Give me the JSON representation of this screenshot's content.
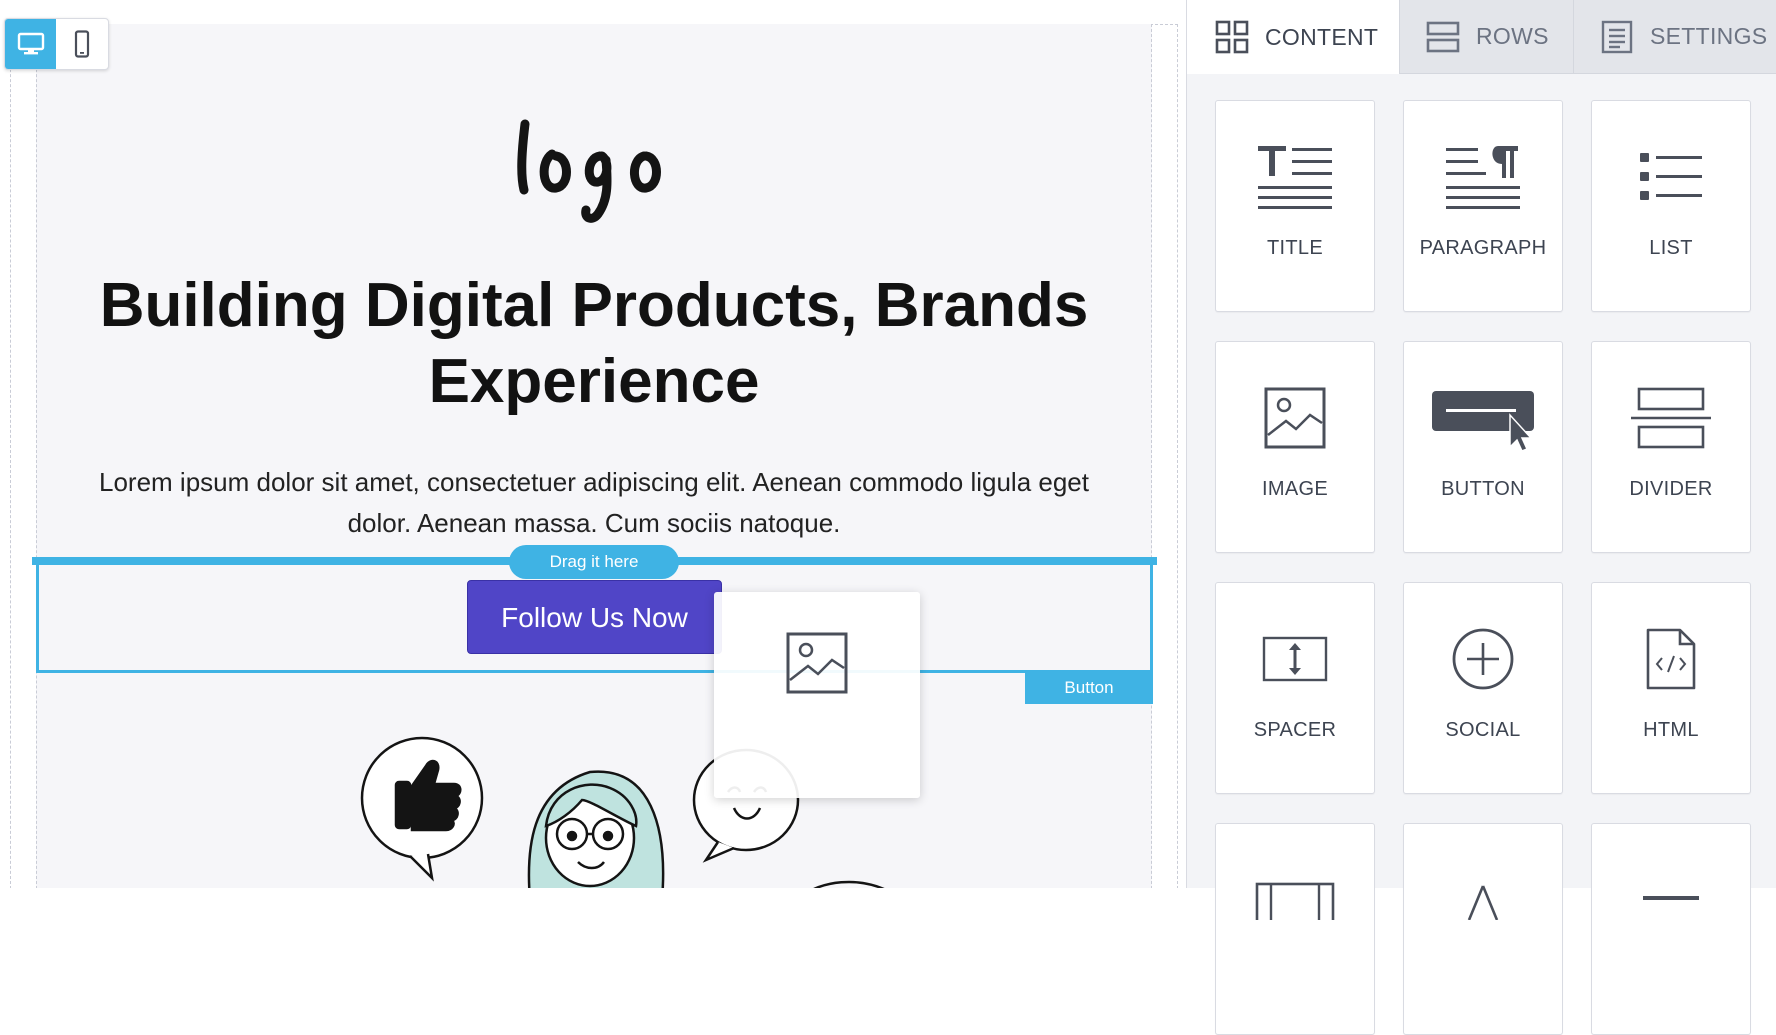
{
  "canvas": {
    "logo_text": "logo",
    "headline_line1": "Building Digital Products, Brands",
    "headline_line2": "Experience",
    "paragraph_line1": "Lorem ipsum dolor sit amet, consectetuer adipiscing elit. Aenean commodo ligula eget",
    "paragraph_line2": "dolor. Aenean massa. Cum sociis natoque.",
    "drop_hint": "Drag it here",
    "cta_label": "Follow Us Now",
    "selected_block_tag": "Button",
    "device_modes": [
      "desktop",
      "mobile"
    ],
    "active_device": "desktop"
  },
  "sidebar": {
    "tabs": [
      {
        "label": "CONTENT",
        "icon": "grid-icon",
        "active": true
      },
      {
        "label": "ROWS",
        "icon": "rows-icon",
        "active": false
      },
      {
        "label": "SETTINGS",
        "icon": "settings-icon",
        "active": false
      }
    ],
    "blocks": [
      {
        "label": "TITLE",
        "icon": "title-icon"
      },
      {
        "label": "PARAGRAPH",
        "icon": "paragraph-icon"
      },
      {
        "label": "LIST",
        "icon": "list-icon"
      },
      {
        "label": "IMAGE",
        "icon": "image-icon"
      },
      {
        "label": "BUTTON",
        "icon": "button-icon"
      },
      {
        "label": "DIVIDER",
        "icon": "divider-icon"
      },
      {
        "label": "SPACER",
        "icon": "spacer-icon"
      },
      {
        "label": "SOCIAL",
        "icon": "social-icon"
      },
      {
        "label": "HTML",
        "icon": "html-icon"
      }
    ]
  },
  "colors": {
    "accent": "#3fb3e4",
    "cta": "#5045c7",
    "canvas_bg": "#f6f6f9",
    "sidebar_bg": "#f3f4f7"
  }
}
